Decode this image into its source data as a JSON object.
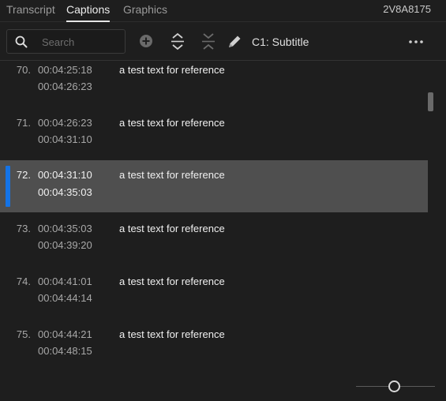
{
  "tabs": [
    {
      "label": "Transcript",
      "active": false
    },
    {
      "label": "Captions",
      "active": true
    },
    {
      "label": "Graphics",
      "active": false
    }
  ],
  "sequence_id": "2V8A8175",
  "toolbar": {
    "search_placeholder": "Search",
    "track_label": "C1: Subtitle",
    "icons": [
      "search-icon",
      "add-icon",
      "expand-icon",
      "collapse-icon",
      "pencil-icon",
      "more-icon"
    ]
  },
  "captions": [
    {
      "num": "70.",
      "in": "00:04:25:18",
      "out": "00:04:26:23",
      "text": "a test text for reference",
      "selected": false
    },
    {
      "num": "71.",
      "in": "00:04:26:23",
      "out": "00:04:31:10",
      "text": "a test text for reference",
      "selected": false
    },
    {
      "num": "72.",
      "in": "00:04:31:10",
      "out": "00:04:35:03",
      "text": "a test text for reference",
      "selected": true
    },
    {
      "num": "73.",
      "in": "00:04:35:03",
      "out": "00:04:39:20",
      "text": "a test text for reference",
      "selected": false
    },
    {
      "num": "74.",
      "in": "00:04:41:01",
      "out": "00:04:44:14",
      "text": "a test text for reference",
      "selected": false
    },
    {
      "num": "75.",
      "in": "00:04:44:21",
      "out": "00:04:48:15",
      "text": "a test text for reference",
      "selected": false
    }
  ],
  "colors": {
    "accent": "#1473e6",
    "selected_row": "#4f4f4f",
    "background": "#1e1e1e"
  }
}
